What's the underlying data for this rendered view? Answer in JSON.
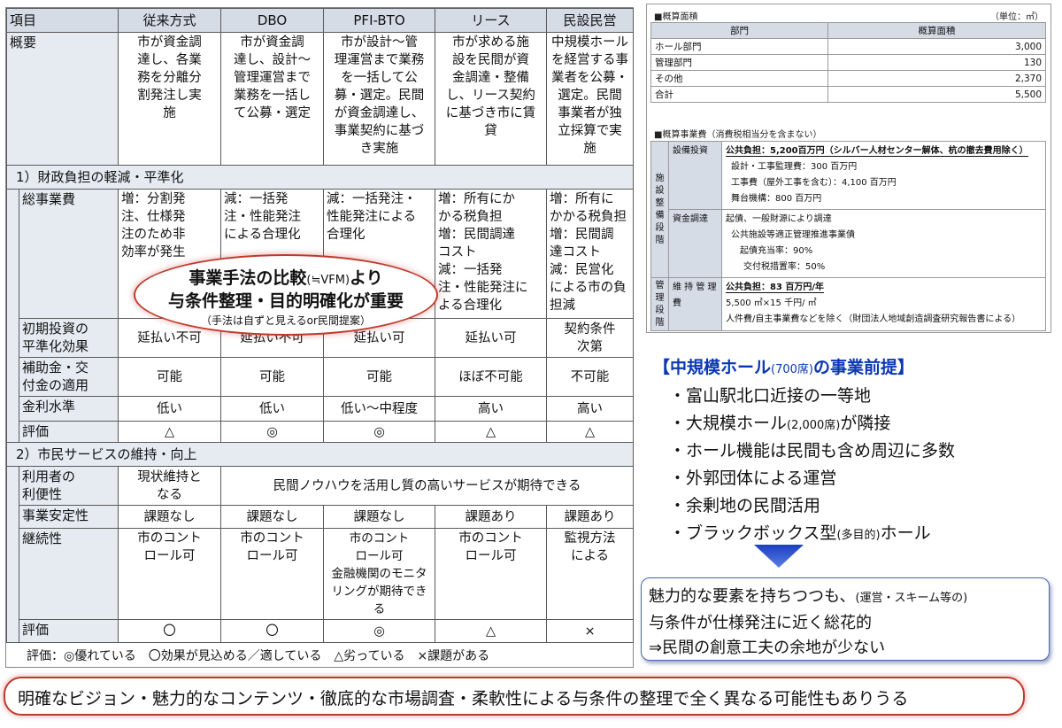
{
  "table": {
    "headers": [
      "項目",
      "従来方式",
      "DBO",
      "PFI-BTO",
      "リース",
      "民設民営"
    ],
    "overview": {
      "label": "概要",
      "cells": [
        [
          "市が資金調",
          "達し、各業",
          "務を分離分",
          "割発注し実",
          "施"
        ],
        [
          "市が資金調",
          "達し、設計～",
          "管理運営まで",
          "業務を一括し",
          "て公募・選定"
        ],
        [
          "市が設計～管",
          "理運営まで業務",
          "を一括して公",
          "募・選定。民間",
          "が資金調達し、",
          "事業契約に基づ",
          "き実施"
        ],
        [
          "市が求める施",
          "設を民間が資",
          "金調達・整備",
          "し、リース契約",
          "に基づき市に賃",
          "貸"
        ],
        [
          "中規模ホール",
          "を経営する事",
          "業者を公募・",
          "選定。民間",
          "事業者が独",
          "立採算で実",
          "施"
        ]
      ]
    },
    "section1": {
      "title": "1）財政負担の軽減・平準化",
      "total_cost": {
        "label": "総事業費",
        "cells": [
          [
            "増：分割発",
            "注、仕様発",
            "注のため非",
            "効率が発生"
          ],
          [
            "減：一括発",
            "注・性能発注",
            "による合理化"
          ],
          [
            "減：一括発注・",
            "性能発注による",
            "合理化"
          ],
          [
            "増：所有にか",
            "かる税負担",
            "増：民間調達",
            "コスト",
            "減：一括発",
            "注・性能発注に",
            "よる合理化"
          ],
          [
            "増：所有に",
            "かかる税負担",
            "増：民間調",
            "達コスト",
            "減：民営化",
            "による市の負",
            "担減"
          ]
        ]
      },
      "initial": {
        "label_l1": "初期投資の",
        "label_l2": "平準化効果",
        "cells": [
          "延払い不可",
          "延払い不可",
          "延払い可",
          "延払い可"
        ],
        "last_l1": "契約条件",
        "last_l2": "次第"
      },
      "subsidy": {
        "label_l1": "補助金・交",
        "label_l2": "付金の適用",
        "cells": [
          "可能",
          "可能",
          "可能",
          "ほぼ不可能",
          "不可能"
        ]
      },
      "interest": {
        "label": "金利水準",
        "cells": [
          "低い",
          "低い",
          "低い～中程度",
          "高い",
          "高い"
        ]
      },
      "eval": {
        "label": "評価",
        "cells": [
          "△",
          "◎",
          "◎",
          "△",
          "△"
        ]
      }
    },
    "section2": {
      "title": "2）市民サービスの維持・向上",
      "convenience": {
        "label_l1": "利用者の",
        "label_l2": "利便性",
        "first_l1": "現状維持と",
        "first_l2": "なる",
        "rest": "民間ノウハウを活用し質の高いサービスが期待できる"
      },
      "stability": {
        "label": "事業安定性",
        "cells": [
          "課題なし",
          "課題なし",
          "課題なし",
          "課題あり",
          "課題あり"
        ]
      },
      "continuity": {
        "label": "継続性",
        "cells": [
          [
            "市のコント",
            "ロール可"
          ],
          [
            "市のコント",
            "ロール可"
          ],
          [
            "市のコント",
            "ロール可",
            "金融機関のモニタ",
            "リングが期待できる"
          ],
          [
            "市のコント",
            "ロール可"
          ],
          [
            "監視方法",
            "による"
          ]
        ]
      },
      "eval": {
        "label": "評価",
        "cells": [
          "〇",
          "〇",
          "◎",
          "△",
          "×"
        ]
      }
    },
    "legend": "評価：◎優れている　〇効果が見込める／適している　△劣っている　×課題がある"
  },
  "callout": {
    "line1_main": "事業手法の比較",
    "line1_small": "(≒VFM)",
    "line1_tail": "より",
    "line2": "与条件整理・目的明確化が重要",
    "line3": "（手法は自ずと見えるor民間提案）"
  },
  "area_table": {
    "title": "■概算面積",
    "unit": "（単位：㎡）",
    "headers": [
      "部門",
      "概算面積"
    ],
    "rows": [
      {
        "name": "ホール部門",
        "value": "3,000"
      },
      {
        "name": "管理部門",
        "value": "130"
      },
      {
        "name": "その他",
        "value": "2,370"
      },
      {
        "name": "合計",
        "value": "5,500"
      }
    ]
  },
  "cost_table": {
    "title": "■概算事業費（消費税相当分を含まない）",
    "stage1": [
      "施",
      "設",
      "整",
      "備",
      "段",
      "階"
    ],
    "stage2": [
      "管",
      "理",
      "段",
      "階"
    ],
    "equip_label": "設備投資",
    "equip_lines": [
      "公共負担：5,200百万円（シルバー人材センター解体、杭の撤去費用除く）",
      "設計・工事監理費：300 百万円",
      "工事費（屋外工事を含む）：4,100 百万円",
      "舞台機構：800 百万円"
    ],
    "fund_label": "資金調達",
    "fund_lines": [
      "起債、一般財源により調達",
      "公共施設等適正管理推進事業債",
      "起債充当率：90%",
      "交付税措置率：50%"
    ],
    "maint_label_l1": "維 持 管 理",
    "maint_label_l2": "費",
    "maint_lines": [
      "公共負担：83 百万円/年",
      "5,500 ㎡×15 千円/ ㎡",
      "人件費/自主事業費などを除く（財団法人地域創造調査研究報告書による）"
    ]
  },
  "premises": {
    "title_a": "【中規模ホール",
    "title_small": "(700席)",
    "title_b": "の事業前提】",
    "items": [
      {
        "text": "・富山駅北口近接の一等地",
        "small": "",
        "tail": ""
      },
      {
        "text": "・大規模ホール",
        "small": "(2,000席)",
        "tail": "が隣接"
      },
      {
        "text": "・ホール機能は民間も含め周辺に多数",
        "small": "",
        "tail": ""
      },
      {
        "text": "・外郭団体による運営",
        "small": "",
        "tail": ""
      },
      {
        "text": "・余剰地の民間活用",
        "small": "",
        "tail": ""
      },
      {
        "text": "・ブラックボックス型",
        "small": "(多目的)",
        "tail": "ホール"
      }
    ]
  },
  "conclusion": {
    "l1_main": "魅力的な要素を持ちつつも、",
    "l1_small": "(運営・スキーム等の)",
    "l2": "与条件が仕様発注に近く総花的",
    "l3": "⇒民間の創意工夫の余地が少ない"
  },
  "bottom_note": "明確なビジョン・魅力的なコンテンツ・徹底的な市場調査・柔軟性による与条件の整理で全く異なる可能性もありうる"
}
